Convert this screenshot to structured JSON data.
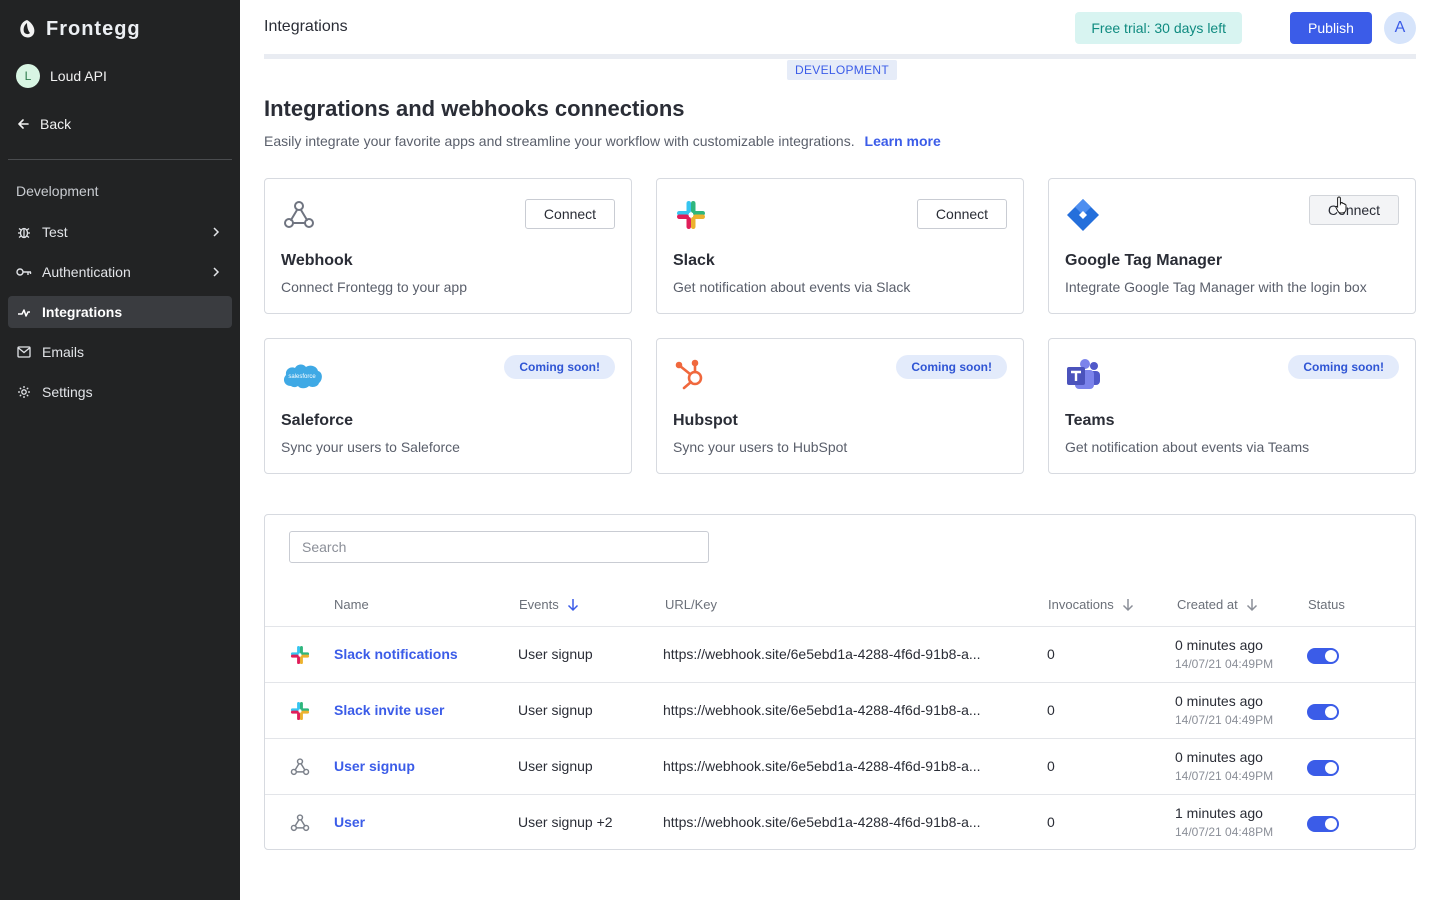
{
  "brand": {
    "name": "Frontegg"
  },
  "workspace": {
    "initial": "L",
    "name": "Loud API"
  },
  "sidebar": {
    "back_label": "Back",
    "section_label": "Development",
    "items": [
      {
        "label": "Test",
        "icon": "bug-icon",
        "has_children": true
      },
      {
        "label": "Authentication",
        "icon": "key-icon",
        "has_children": true
      },
      {
        "label": "Integrations",
        "icon": "integrations-icon",
        "active": true
      },
      {
        "label": "Emails",
        "icon": "mail-icon"
      },
      {
        "label": "Settings",
        "icon": "gear-icon"
      }
    ]
  },
  "header": {
    "title": "Integrations",
    "trial_label": "Free trial: 30 days left",
    "publish_label": "Publish",
    "user_initial": "A",
    "environment": "DEVELOPMENT"
  },
  "intro": {
    "heading": "Integrations and webhooks connections",
    "description": "Easily integrate your favorite apps and streamline your workflow with customizable integrations.",
    "learn_more": "Learn more"
  },
  "cards": [
    {
      "title": "Webhook",
      "description": "Connect Frontegg to your app",
      "action": "Connect",
      "icon": "webhook-icon"
    },
    {
      "title": "Slack",
      "description": "Get notification about events via Slack",
      "action": "Connect",
      "icon": "slack-icon"
    },
    {
      "title": "Google Tag Manager",
      "description": "Integrate Google Tag Manager with the login box",
      "action": "Connect",
      "icon": "google-tag-manager-icon"
    },
    {
      "title": "Saleforce",
      "description": "Sync your users to Saleforce",
      "badge": "Coming soon!",
      "icon": "salesforce-icon",
      "icon_text": "salesforce"
    },
    {
      "title": "Hubspot",
      "description": "Sync your users to HubSpot",
      "badge": "Coming soon!",
      "icon": "hubspot-icon"
    },
    {
      "title": "Teams",
      "description": "Get notification about events via Teams",
      "badge": "Coming soon!",
      "icon": "teams-icon"
    }
  ],
  "table": {
    "search_placeholder": "Search",
    "columns": [
      "Name",
      "Events",
      "URL/Key",
      "Invocations",
      "Created at",
      "Status"
    ],
    "rows": [
      {
        "icon": "slack-icon",
        "name": "Slack notifications",
        "events": "User signup",
        "url": "https://webhook.site/6e5ebd1a-4288-4f6d-91b8-a...",
        "invocations": "0",
        "created_rel": "0 minutes ago",
        "created_abs": "14/07/21 04:49PM",
        "enabled": true
      },
      {
        "icon": "slack-icon",
        "name": "Slack invite user",
        "events": "User signup",
        "url": "https://webhook.site/6e5ebd1a-4288-4f6d-91b8-a...",
        "invocations": "0",
        "created_rel": "0 minutes ago",
        "created_abs": "14/07/21 04:49PM",
        "enabled": true
      },
      {
        "icon": "webhook-icon",
        "name": "User signup",
        "events": "User signup",
        "url": "https://webhook.site/6e5ebd1a-4288-4f6d-91b8-a...",
        "invocations": "0",
        "created_rel": "0 minutes ago",
        "created_abs": "14/07/21 04:49PM",
        "enabled": true
      },
      {
        "icon": "webhook-icon",
        "name": "User",
        "events": "User signup +2",
        "url": "https://webhook.site/6e5ebd1a-4288-4f6d-91b8-a...",
        "invocations": "0",
        "created_rel": "1 minutes ago",
        "created_abs": "14/07/21 04:48PM",
        "enabled": true
      }
    ]
  },
  "colors": {
    "accent": "#3b5ce8",
    "sidebar_bg": "#222324",
    "trial_bg": "#d8f4f1"
  }
}
